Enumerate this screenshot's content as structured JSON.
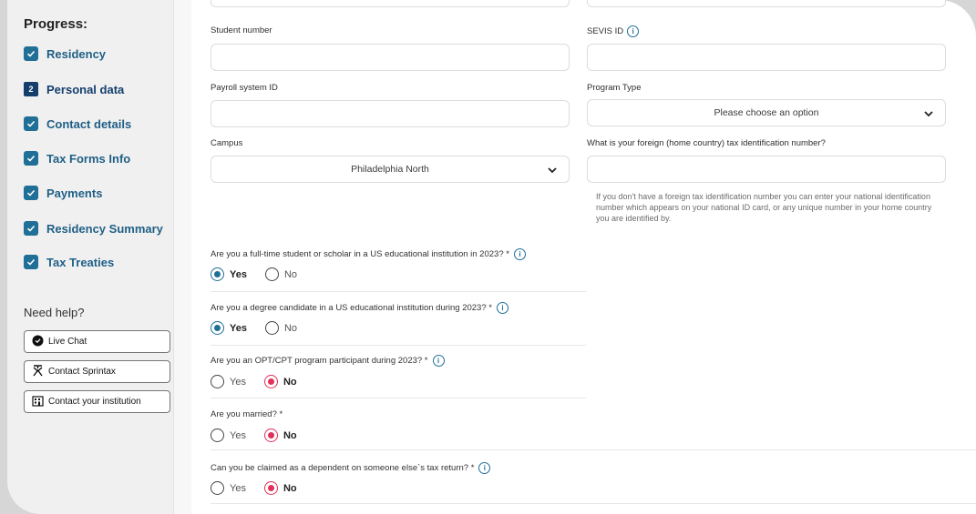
{
  "sidebar": {
    "progress_title": "Progress:",
    "steps": [
      {
        "label": "Residency",
        "status": "done"
      },
      {
        "label": "Personal data",
        "status": "active",
        "number": "2"
      },
      {
        "label": "Contact details",
        "status": "done"
      },
      {
        "label": "Tax Forms Info",
        "status": "done"
      },
      {
        "label": "Payments",
        "status": "done"
      },
      {
        "label": "Residency Summary",
        "status": "done"
      },
      {
        "label": "Tax Treaties",
        "status": "done"
      }
    ],
    "help_title": "Need help?",
    "help_buttons": [
      {
        "label": "Live Chat",
        "icon": "chat-bubble-icon"
      },
      {
        "label": "Contact Sprintax",
        "icon": "sprintax-logo-icon"
      },
      {
        "label": "Contact your institution",
        "icon": "building-icon"
      }
    ]
  },
  "form": {
    "student_number": {
      "label": "Student number",
      "value": ""
    },
    "sevis_id": {
      "label": "SEVIS ID",
      "value": ""
    },
    "payroll_id": {
      "label": "Payroll system ID",
      "value": ""
    },
    "program_type": {
      "label": "Program Type",
      "value": "Please choose an option"
    },
    "campus": {
      "label": "Campus",
      "value": "Philadelphia North"
    },
    "foreign_tin": {
      "label": "What is your foreign (home country) tax identification number?",
      "value": "",
      "hint": "If you don't have a foreign tax identification number you can enter your national identification number which appears on your national ID card, or any unique number in your home country you are identified by."
    }
  },
  "questions": [
    {
      "text": "Are you a full-time student or scholar in a US educational institution in 2023? *",
      "info": true,
      "yes": "Yes",
      "no": "No",
      "selected": "yes"
    },
    {
      "text": "Are you a degree candidate in a US educational institution during 2023? *",
      "info": true,
      "yes": "Yes",
      "no": "No",
      "selected": "yes"
    },
    {
      "text": "Are you an OPT/CPT program participant during 2023? *",
      "info": true,
      "yes": "Yes",
      "no": "No",
      "selected": "no"
    },
    {
      "text": "Are you married? *",
      "info": false,
      "yes": "Yes",
      "no": "No",
      "selected": "no"
    },
    {
      "text": "Can you be claimed as a dependent on someone else`s tax return? *",
      "info": true,
      "yes": "Yes",
      "no": "No",
      "selected": "no"
    }
  ],
  "colors": {
    "accent": "#1f6f97",
    "navy": "#143f6d",
    "no_selected": "#e0315a"
  }
}
